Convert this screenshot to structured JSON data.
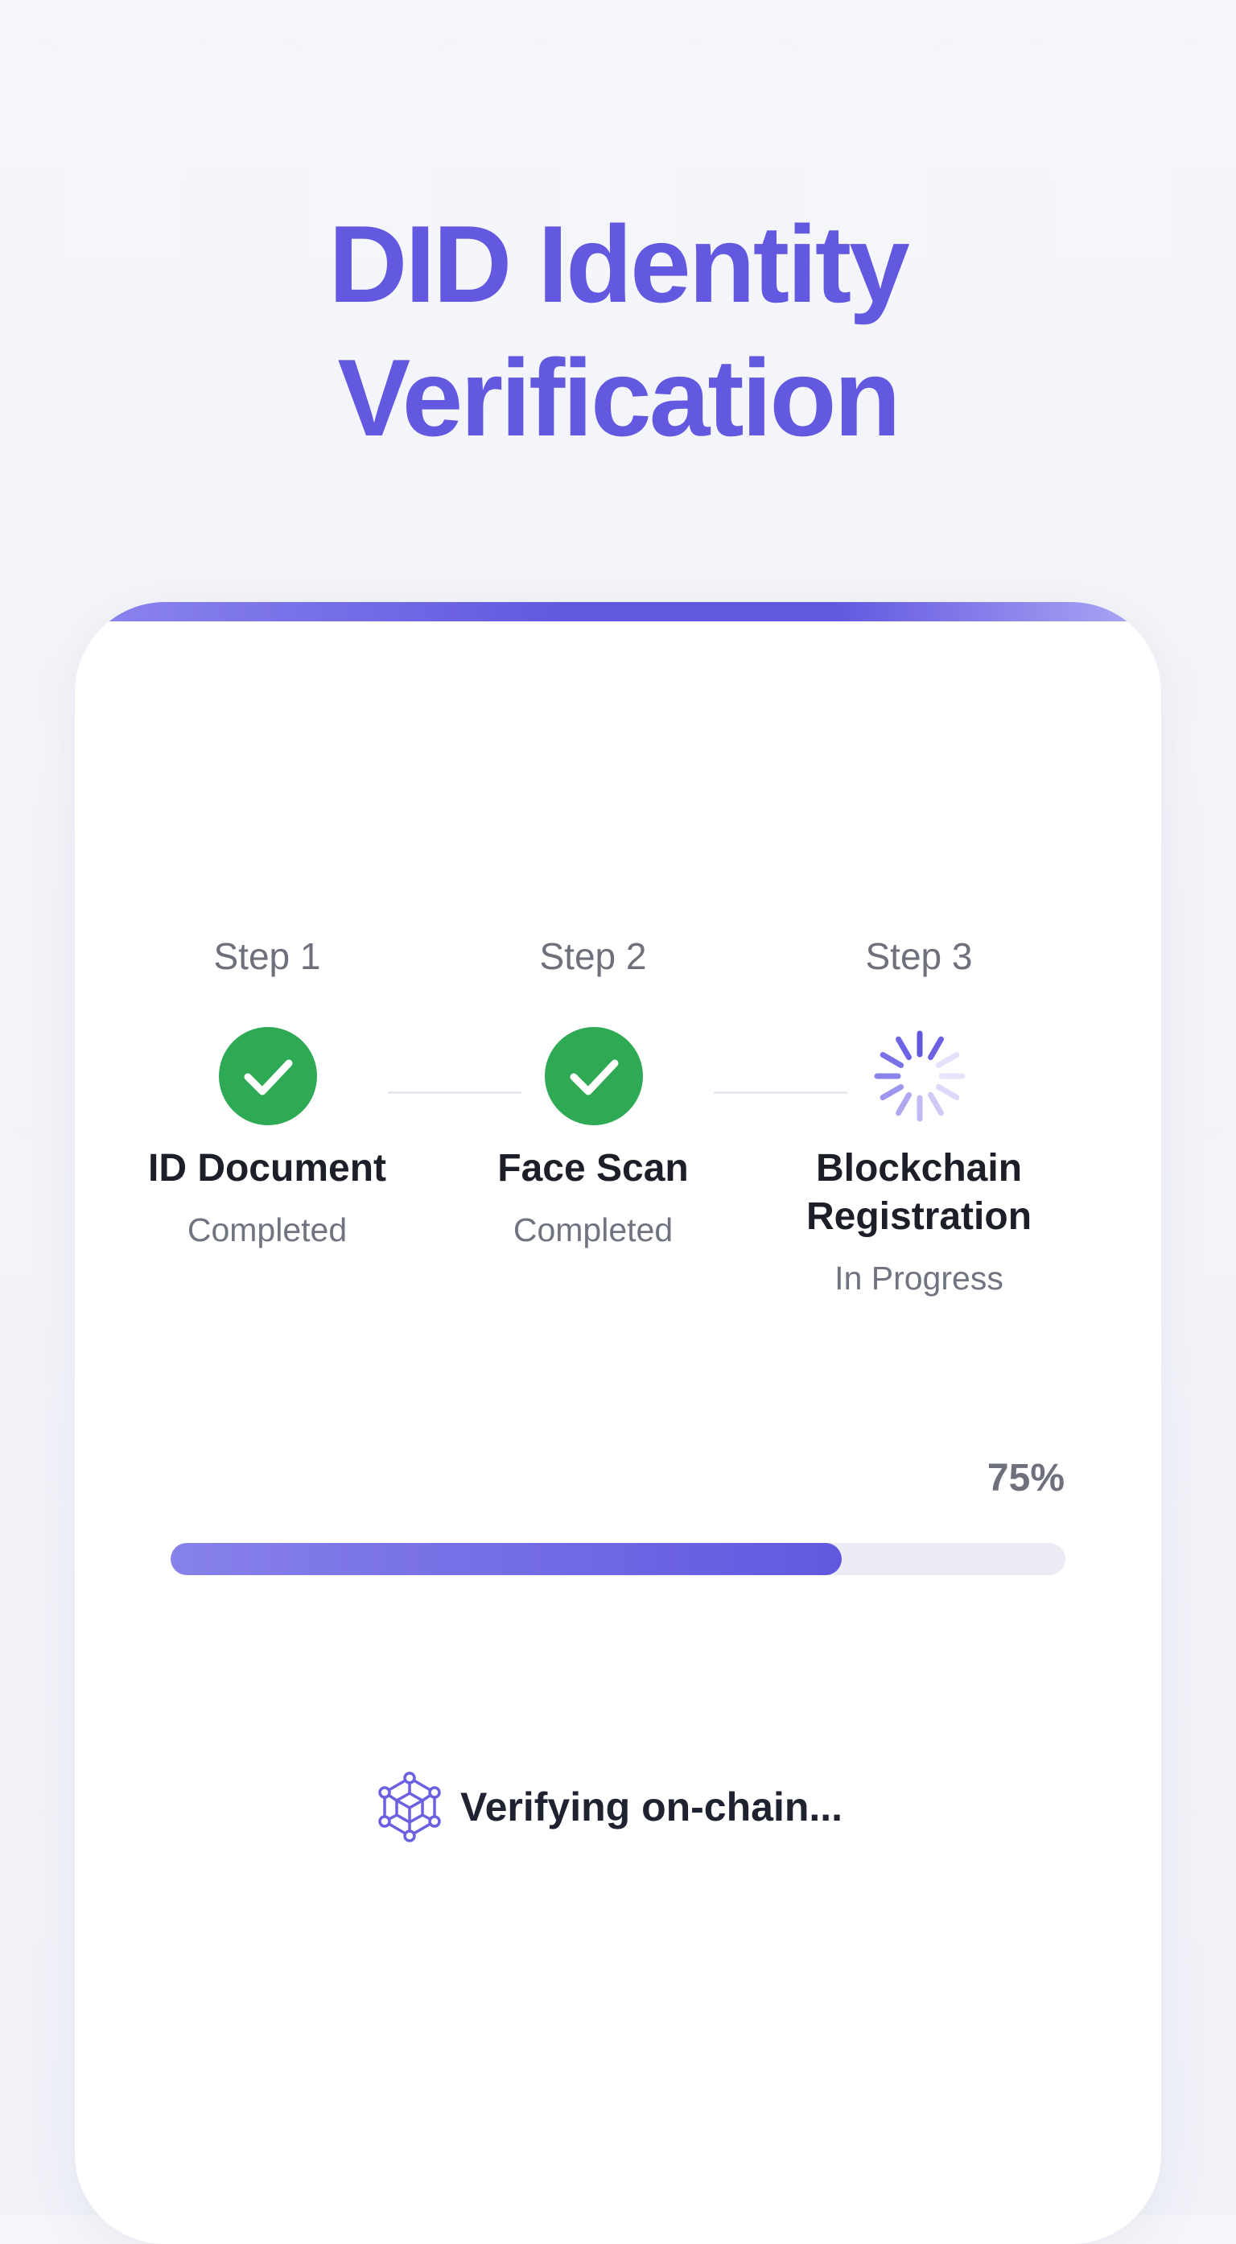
{
  "header": {
    "title_line1": "DID Identity",
    "title_line2": "Verification"
  },
  "steps": [
    {
      "label": "Step 1",
      "name_line1": "ID Document",
      "name_line2": "",
      "status": "Completed",
      "state": "done"
    },
    {
      "label": "Step 2",
      "name_line1": "Face Scan",
      "name_line2": "",
      "status": "Completed",
      "state": "done"
    },
    {
      "label": "Step 3",
      "name_line1": "Blockchain",
      "name_line2": "Registration",
      "status": "In Progress",
      "state": "in-progress"
    }
  ],
  "progress": {
    "percent_label": "75%",
    "value": 0.75
  },
  "status": {
    "text": "Verifying on-chain...",
    "icon": "blockchain-cube-icon"
  },
  "colors": {
    "accent": "#6258e0",
    "success": "#2eaa55",
    "track": "#ebecf4"
  }
}
